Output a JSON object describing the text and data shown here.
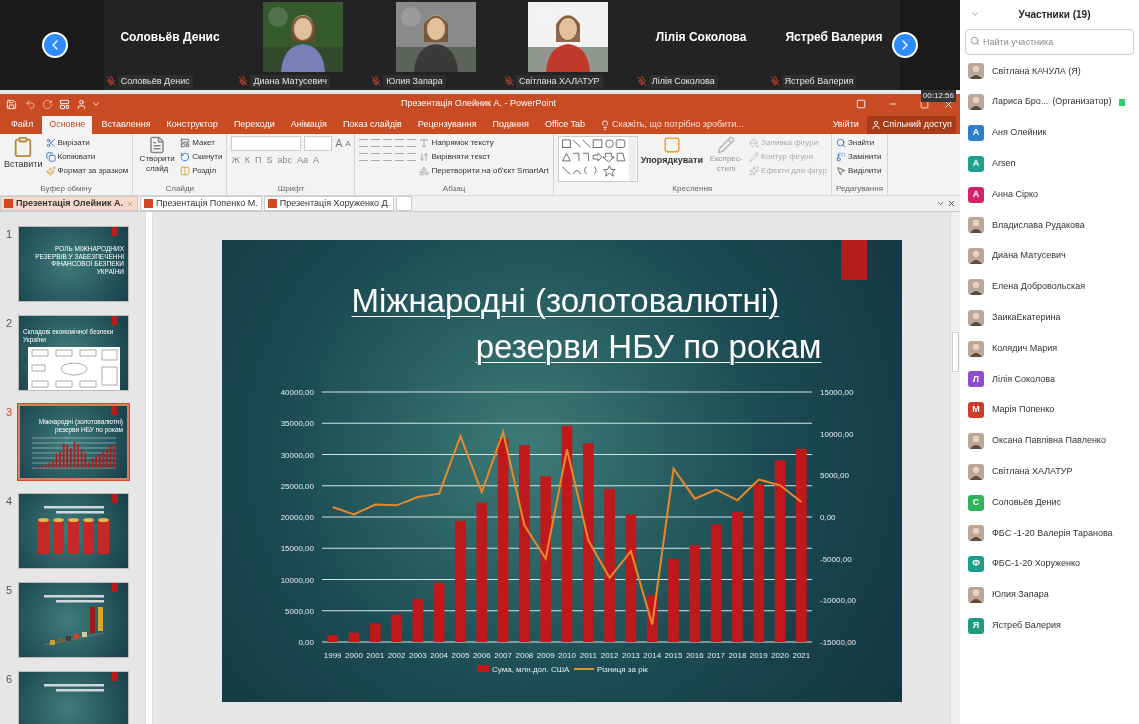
{
  "video_strip": {
    "tiles": [
      {
        "name": "Соловьёв Денис",
        "label": "Соловьёв Денис",
        "kind": "name",
        "muted": true
      },
      {
        "label": "Диана Матусевич",
        "kind": "picture",
        "muted": true
      },
      {
        "label": "Юлия Запара",
        "kind": "picture",
        "muted": true
      },
      {
        "label": "Світлана ХАЛАТУР",
        "kind": "picture",
        "muted": true
      },
      {
        "name": "Лілія Соколова",
        "label": "Лілія Соколова",
        "kind": "name",
        "muted": true
      },
      {
        "name": "Ястреб Валерия",
        "label": "Ястреб Валерия",
        "kind": "name",
        "muted": true
      }
    ]
  },
  "powerpoint": {
    "timer": "00:12:56",
    "window_title": "Презентація Олейник А. - PowerPoint",
    "menu_tabs": [
      {
        "label": "Файл",
        "selected": false
      },
      {
        "label": "Основне",
        "selected": true
      },
      {
        "label": "Вставлення",
        "selected": false
      },
      {
        "label": "Конструктор",
        "selected": false
      },
      {
        "label": "Переходи",
        "selected": false
      },
      {
        "label": "Анімація",
        "selected": false
      },
      {
        "label": "Показ слайдів",
        "selected": false
      },
      {
        "label": "Рецензування",
        "selected": false
      },
      {
        "label": "Подання",
        "selected": false
      },
      {
        "label": "Office Tab",
        "selected": false
      }
    ],
    "tell_me": "Скажіть, що потрібно зробити...",
    "sign_in": "Увійти",
    "share": "Спільний доступ",
    "ribbon": {
      "clipboard": {
        "title": "Буфер обміну",
        "paste": "Вставити",
        "items": [
          "Вирізати",
          "Копіювати",
          "Формат за зразком"
        ]
      },
      "slides": {
        "title": "Слайди",
        "new_slide": "Створити слайд",
        "items": [
          "Макет",
          "Скинути",
          "Розділ"
        ]
      },
      "font": {
        "title": "Шрифт",
        "grow": "A",
        "shrink": "A",
        "styles": [
          "Ж",
          "К",
          "П",
          "S",
          "abc",
          "Aa"
        ],
        "font_color_label": "A"
      },
      "paragraph": {
        "title": "Абзац",
        "items": [
          "Напрямок тексту",
          "Вирівняти текст",
          "Перетворити на об'єкт SmartArt"
        ]
      },
      "drawing": {
        "title": "Креслення",
        "arrange": "Упорядкувати",
        "quick_styles": "Експрес-стилі",
        "items": [
          "Заливка фігури",
          "Контур фігури",
          "Ефекти для фігур"
        ]
      },
      "editing": {
        "title": "Редагування",
        "items": [
          "Знайти",
          "Замінити",
          "Виділити"
        ]
      }
    },
    "doc_tabs": [
      {
        "label": "Презентація Олейник А.",
        "selected": true
      },
      {
        "label": "Презентація Попенко М.",
        "selected": false
      },
      {
        "label": "Презентація Хоруженко Д.",
        "selected": false
      }
    ],
    "thumbnails": [
      {
        "number": "1",
        "title": "РОЛЬ МІЖНАРОДНИХ РЕЗЕРВІВ У ЗАБЕЗПЕЧЕННІ ФІНАНСОВОЇ БЕЗПЕКИ УКРАЇНИ",
        "kind": "title",
        "selected": false
      },
      {
        "number": "2",
        "title": "Складові економічної безпеки України",
        "kind": "diagram",
        "selected": false
      },
      {
        "number": "3",
        "title": "Міжнародні (золотовалютні) резерви НБУ по рокам",
        "kind": "chart",
        "selected": true
      },
      {
        "number": "4",
        "kind": "cylinders",
        "selected": false
      },
      {
        "number": "5",
        "kind": "bars3d",
        "selected": false
      },
      {
        "number": "6",
        "kind": "title",
        "selected": false
      }
    ],
    "slide": {
      "title_lines": [
        "Міжнародні (золотовалютні)",
        "резерви НБУ по рокам"
      ],
      "chart_data": {
        "type": "bar",
        "grid": true,
        "legend": true,
        "categories": [
          "1999",
          "2000",
          "2001",
          "2002",
          "2003",
          "2004",
          "2005",
          "2006",
          "2007",
          "2008",
          "2009",
          "2010",
          "2011",
          "2012",
          "2013",
          "2014",
          "2015",
          "2016",
          "2017",
          "2018",
          "2019",
          "2020",
          "2021"
        ],
        "series": [
          {
            "name": "Сума, млн.дол. США",
            "color": "#c0191c",
            "type": "bar",
            "values": [
              1100,
              1500,
              3000,
              4400,
              6900,
              9500,
              19400,
              22300,
              32500,
              31500,
              26500,
              34600,
              31800,
              24500,
              20400,
              7500,
              13300,
              15500,
              18800,
              20800,
              25300,
              29100,
              30900
            ]
          },
          {
            "name": "Різниця за рік",
            "color": "#e8892a",
            "type": "line",
            "axis": "y2",
            "values": [
              1200,
              300,
              1500,
              1400,
              2400,
              2800,
              9700,
              3000,
              10200,
              -1000,
              -5000,
              8100,
              -2800,
              -7300,
              -4100,
              -12900,
              5800,
              2200,
              3300,
              2000,
              4500,
              3800,
              1800
            ]
          }
        ],
        "ylim": [
          0,
          40000
        ],
        "yticks": [
          {
            "value": 0,
            "label": "0,00"
          },
          {
            "value": 5000,
            "label": "5000,00"
          },
          {
            "value": 10000,
            "label": "10000,00"
          },
          {
            "value": 15000,
            "label": "15000,00"
          },
          {
            "value": 20000,
            "label": "20000,00"
          },
          {
            "value": 25000,
            "label": "25000,00"
          },
          {
            "value": 30000,
            "label": "30000,00"
          },
          {
            "value": 35000,
            "label": "35000,00"
          },
          {
            "value": 40000,
            "label": "40000,00"
          }
        ],
        "y2lim": [
          -15000,
          15000
        ],
        "y2ticks": [
          {
            "value": -15000,
            "label": "-15000,00"
          },
          {
            "value": -10000,
            "label": "-10000,00"
          },
          {
            "value": -5000,
            "label": "-5000,00"
          },
          {
            "value": 0,
            "label": "0,00"
          },
          {
            "value": 5000,
            "label": "5000,00"
          },
          {
            "value": 10000,
            "label": "10000,00"
          },
          {
            "value": 15000,
            "label": "15000,00"
          }
        ]
      }
    }
  },
  "participants": {
    "title": "Участники (19)",
    "search": {
      "placeholder": "Найти участника"
    },
    "list": [
      {
        "name": "Світлана КАЧУЛА (Я)"
      },
      {
        "name": "Лариса Бро...",
        "role": "(Организатор)"
      },
      {
        "name": "Аня Олейник",
        "kind": "letter",
        "letter": "А",
        "color": "#2f7ec9"
      },
      {
        "name": "Arsen",
        "kind": "letter",
        "letter": "A",
        "color": "#1fa38a"
      },
      {
        "name": "Анна Сірко",
        "kind": "letter",
        "letter": "А",
        "color": "#d3246a"
      },
      {
        "name": "Владислава Рудакова"
      },
      {
        "name": "Диана Матусевич"
      },
      {
        "name": "Елена Добровольская"
      },
      {
        "name": "ЗаикаЕкатерина"
      },
      {
        "name": "Колядич Мария"
      },
      {
        "name": "Лілія Соколова",
        "kind": "letter",
        "letter": "Л",
        "color": "#8e4ccf"
      },
      {
        "name": "Марія Попенко",
        "kind": "letter",
        "letter": "М",
        "color": "#cf3b2b"
      },
      {
        "name": "Оксана Павлівна Павленко"
      },
      {
        "name": "Світлана ХАЛАТУР"
      },
      {
        "name": "Соловьёв Денис",
        "kind": "letter",
        "letter": "С",
        "color": "#2fb35c"
      },
      {
        "name": "ФБС -1-20 Валерія Таранова"
      },
      {
        "name": "ФБС-1-20 Хоруженко",
        "kind": "letter",
        "letter": "Ф",
        "color": "#1a9e86"
      },
      {
        "name": "Юлия Запара"
      },
      {
        "name": "Ястреб Валерия",
        "kind": "letter",
        "letter": "Я",
        "color": "#1e9c7c"
      }
    ]
  }
}
